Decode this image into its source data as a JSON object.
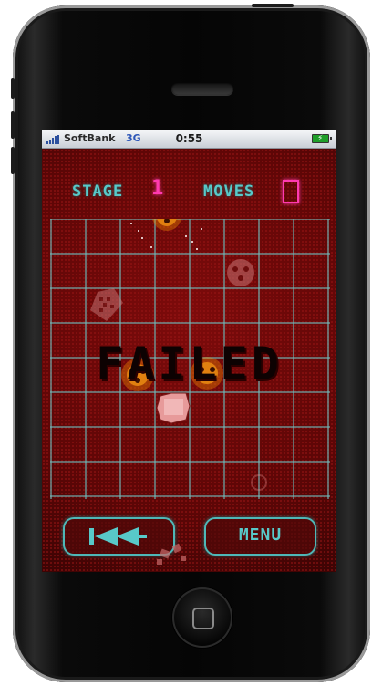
{
  "status_bar": {
    "carrier": "SoftBank",
    "network": "3G",
    "time": "0:55",
    "battery_icon": "battery-charging-icon"
  },
  "hud": {
    "stage_label": "STAGE",
    "stage_value": "1",
    "moves_label": "MOVES",
    "moves_value": "0"
  },
  "game": {
    "result_text": "FAILED",
    "grid_columns": 8,
    "grid_rows": 8
  },
  "controls": {
    "rewind_icon": "rewind-icon",
    "menu_label": "MENU"
  },
  "colors": {
    "background": "#5d0606",
    "grid_line": "#6fbcbc",
    "hud_text": "#58c9c9",
    "hud_value": "#ff3ab0"
  }
}
